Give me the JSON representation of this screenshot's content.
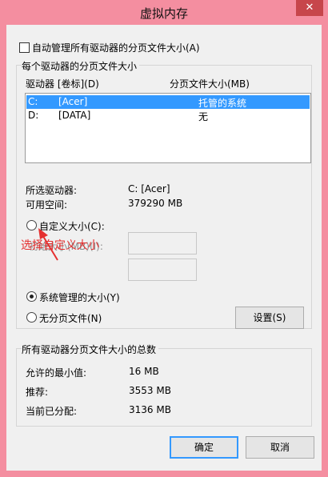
{
  "window": {
    "title": "虚拟内存",
    "close_icon": "✕"
  },
  "auto_manage": {
    "label": "自动管理所有驱动器的分页文件大小(A)",
    "checked": false
  },
  "per_drive": {
    "group_title": "每个驱动器的分页文件大小",
    "columns": [
      "驱动器 [卷标](D)",
      "分页文件大小(MB)"
    ],
    "drives": [
      {
        "drive": "C:",
        "label": "[Acer]",
        "size": "托管的系统",
        "selected": true
      },
      {
        "drive": "D:",
        "label": "[DATA]",
        "size": "无",
        "selected": false
      }
    ],
    "selected_drive_label": "所选驱动器:",
    "selected_drive_value": "C:  [Acer]",
    "free_space_label": "可用空间:",
    "free_space_value": "379290 MB",
    "custom_size_label": "自定义大小(C):",
    "initial_size_label": "初始大小(MB)(I):",
    "system_managed_label": "系统管理的大小(Y)",
    "no_paging_label": "无分页文件(N)",
    "set_button": "设置(S)",
    "selected_option": "system_managed"
  },
  "annotation": {
    "text": "选择自定义大小",
    "color": "#e53030"
  },
  "totals": {
    "group_title": "所有驱动器分页文件大小的总数",
    "min_label": "允许的最小值:",
    "min_value": "16 MB",
    "recommended_label": "推荐:",
    "recommended_value": "3553 MB",
    "allocated_label": "当前已分配:",
    "allocated_value": "3136 MB"
  },
  "buttons": {
    "ok": "确定",
    "cancel": "取消"
  },
  "colors": {
    "frame": "#f48ea0",
    "selection": "#3399ff",
    "close": "#c7464b"
  }
}
